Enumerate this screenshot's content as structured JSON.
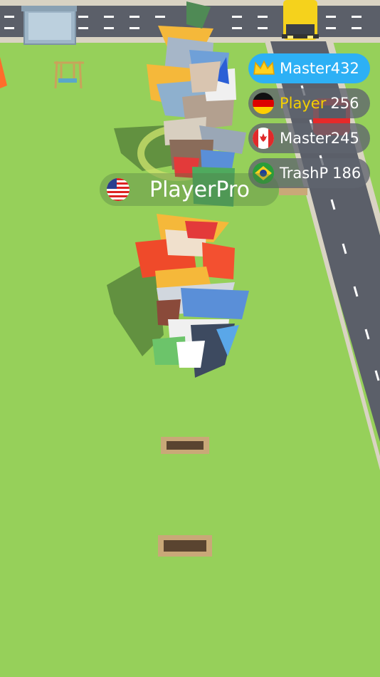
{
  "leaderboard": [
    {
      "rank_icon": "crown-icon",
      "name": "Master432",
      "score": "",
      "highlight": true
    },
    {
      "rank_icon": "flag-germany-icon",
      "name": "Player",
      "score": "256",
      "highlight": false,
      "self": true
    },
    {
      "rank_icon": "flag-canada-icon",
      "name": "Master245",
      "score": "",
      "highlight": false
    },
    {
      "rank_icon": "flag-brazil-icon",
      "name": "TrashP",
      "score": "186",
      "highlight": false
    }
  ],
  "player_tag": {
    "flag_icon": "flag-usa-icon",
    "name": "PlayerPro"
  },
  "colors": {
    "grass": "#96d05a",
    "road": "#5a5f6b",
    "highlight": "#2db0f5",
    "self_name": "#f5d000",
    "row_bg": "#6a6e77"
  }
}
